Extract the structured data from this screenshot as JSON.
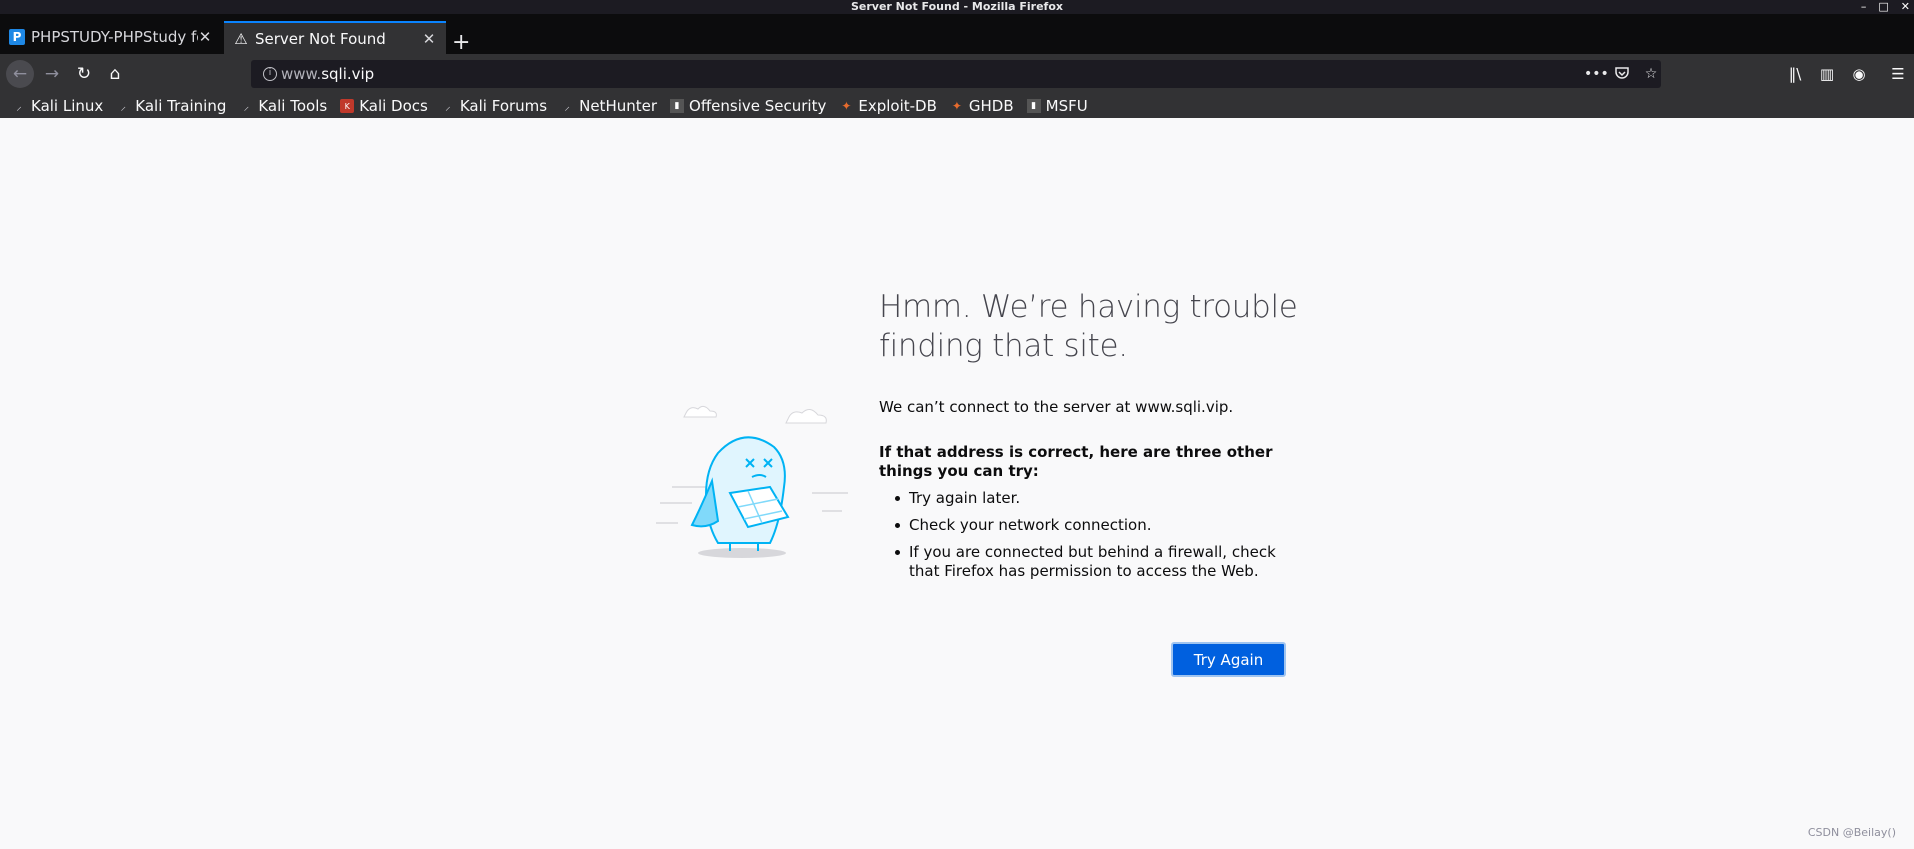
{
  "window": {
    "title": "Server Not Found - Mozilla Firefox",
    "minimize": "–",
    "maximize": "□",
    "close": "✕"
  },
  "tabs": [
    {
      "title": "PHPSTUDY-PHPStudy fo",
      "favicon": "P",
      "icon": "phpstudy-favicon",
      "close": "✕"
    },
    {
      "title": "Server Not Found",
      "favicon": "⚠",
      "icon": "warning-icon",
      "close": "✕",
      "active": true
    }
  ],
  "new_tab": "+",
  "nav": {
    "back": "←",
    "forward": "→",
    "reload": "↻",
    "home": "⌂",
    "url_prefix": "www.",
    "url_domain": "sqli.vip",
    "page_actions": "•••",
    "pocket": "◡",
    "bookmark_star": "☆",
    "library": "‖\\",
    "sidebar": "▥",
    "account": "◉",
    "menu": "☰"
  },
  "bookmarks": [
    {
      "label": "Kali Linux",
      "icon": "kali-dragon-icon",
      "glyph": "⸝",
      "style": "kali"
    },
    {
      "label": "Kali Training",
      "icon": "kali-dragon-icon",
      "glyph": "⸝",
      "style": "kali"
    },
    {
      "label": "Kali Tools",
      "icon": "kali-dragon-icon",
      "glyph": "⸝",
      "style": "kali"
    },
    {
      "label": "Kali Docs",
      "icon": "kali-docs-icon",
      "glyph": "K",
      "style": "red"
    },
    {
      "label": "Kali Forums",
      "icon": "kali-dragon-icon",
      "glyph": "⸝",
      "style": "kali"
    },
    {
      "label": "NetHunter",
      "icon": "nethunter-icon",
      "glyph": "⸝",
      "style": "kali"
    },
    {
      "label": "Offensive Security",
      "icon": "offsec-icon",
      "glyph": "▮",
      "style": "os"
    },
    {
      "label": "Exploit-DB",
      "icon": "exploitdb-icon",
      "glyph": "✦",
      "style": "flame"
    },
    {
      "label": "GHDB",
      "icon": "ghdb-icon",
      "glyph": "✦",
      "style": "flame"
    },
    {
      "label": "MSFU",
      "icon": "msfu-icon",
      "glyph": "▮",
      "style": "os"
    }
  ],
  "error": {
    "title": "Hmm. We’re having trouble finding that site.",
    "description": "We can’t connect to the server at www.sqli.vip.",
    "suggest_heading": "If that address is correct, here are three other things you can try:",
    "suggestions": [
      "Try again later.",
      "Check your network connection.",
      "If you are connected but behind a firewall, check that Firefox has permission to access the Web."
    ],
    "button": "Try Again"
  },
  "watermark": "CSDN @Beilay()",
  "colors": {
    "accent": "#0a84ff",
    "button": "#0060df",
    "illustration": "#00b3f4"
  }
}
